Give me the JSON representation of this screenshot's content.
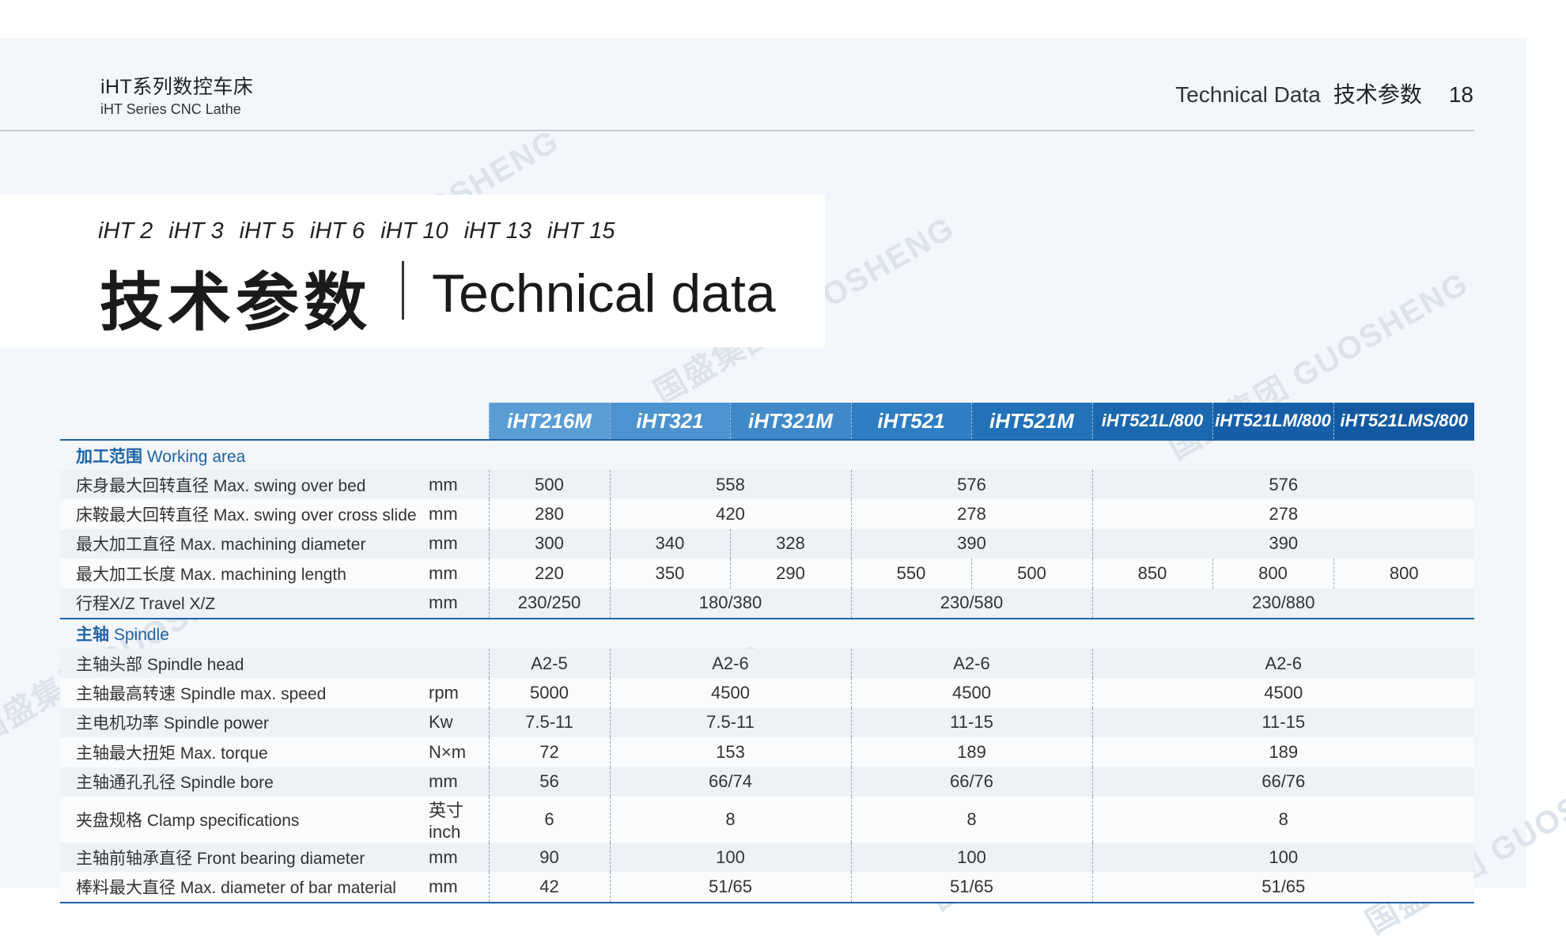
{
  "header": {
    "doc_title_cn": "iHT系列数控车床",
    "doc_title_en": "iHT Series CNC Lathe",
    "section_en": "Technical Data",
    "section_cn": "技术参数",
    "page_number": "18"
  },
  "title": {
    "models": [
      "iHT 2",
      "iHT 3",
      "iHT 5",
      "iHT 6",
      "iHT 10",
      "iHT 13",
      "iHT 15"
    ],
    "cn": "技术参数",
    "en": "Technical data"
  },
  "watermark_text": "国盛集团 GUOSHENG",
  "table": {
    "columns": [
      "iHT216M",
      "iHT321",
      "iHT321M",
      "iHT521",
      "iHT521M",
      "iHT521L/800",
      "iHT521LM/800",
      "iHT521LMS/800"
    ],
    "sections": [
      {
        "title_cn": "加工范围",
        "title_en": "Working area",
        "rows": [
          {
            "label": "床身最大回转直径 Max. swing over bed",
            "unit": "mm",
            "values": [
              "500",
              "558",
              "576",
              "576"
            ]
          },
          {
            "label": "床鞍最大回转直径 Max. swing over cross slide",
            "unit": "mm",
            "values": [
              "280",
              "420",
              "278",
              "278"
            ]
          },
          {
            "label": "最大加工直径 Max. machining diameter",
            "unit": "mm",
            "values": [
              "300",
              "340",
              "328",
              "390",
              "390"
            ]
          },
          {
            "label": "最大加工长度 Max. machining length",
            "unit": "mm",
            "values": [
              "220",
              "350",
              "290",
              "550",
              "500",
              "850",
              "800",
              "800"
            ]
          },
          {
            "label": "行程X/Z Travel X/Z",
            "unit": "mm",
            "values": [
              "230/250",
              "180/380",
              "230/580",
              "230/880"
            ]
          }
        ]
      },
      {
        "title_cn": "主轴",
        "title_en": "Spindle",
        "rows": [
          {
            "label": "主轴头部 Spindle head",
            "unit": "",
            "values": [
              "A2-5",
              "A2-6",
              "A2-6",
              "A2-6"
            ]
          },
          {
            "label": "主轴最高转速 Spindle max. speed",
            "unit": "rpm",
            "values": [
              "5000",
              "4500",
              "4500",
              "4500"
            ]
          },
          {
            "label": "主电机功率 Spindle power",
            "unit": "Kw",
            "values": [
              "7.5-11",
              "7.5-11",
              "11-15",
              "11-15"
            ]
          },
          {
            "label": "主轴最大扭矩 Max. torque",
            "unit": "N×m",
            "values": [
              "72",
              "153",
              "189",
              "189"
            ]
          },
          {
            "label": "主轴通孔孔径 Spindle bore",
            "unit": "mm",
            "values": [
              "56",
              "66/74",
              "66/76",
              "66/76"
            ]
          },
          {
            "label": "夹盘规格 Clamp specifications",
            "unit": "英寸inch",
            "values": [
              "6",
              "8",
              "8",
              "8"
            ]
          },
          {
            "label": "主轴前轴承直径 Front bearing diameter",
            "unit": "mm",
            "values": [
              "90",
              "100",
              "100",
              "100"
            ]
          },
          {
            "label": "棒料最大直径 Max. diameter of bar material",
            "unit": "mm",
            "values": [
              "42",
              "51/65",
              "51/65",
              "51/65"
            ]
          }
        ]
      }
    ]
  }
}
